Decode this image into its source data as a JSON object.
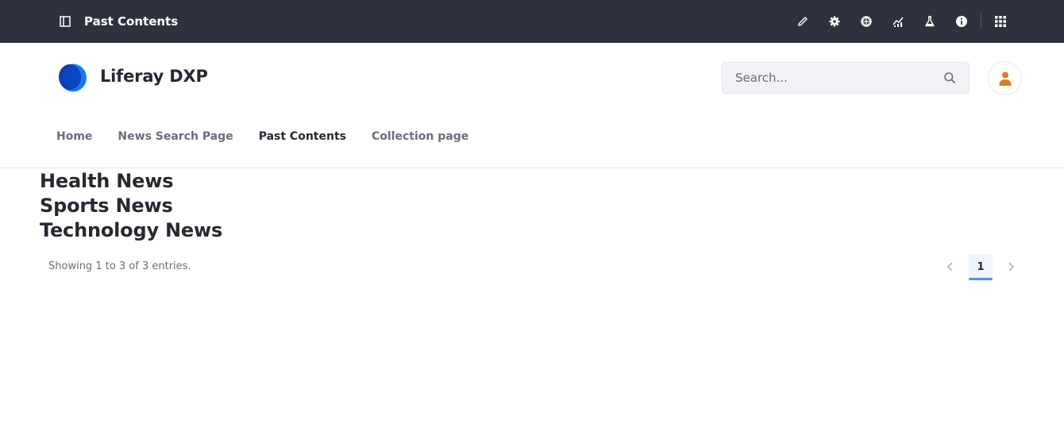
{
  "control_menu": {
    "title": "Past Contents",
    "icons": [
      "pencil-icon",
      "gear-icon",
      "simulation-icon",
      "analytics-icon",
      "flask-icon",
      "info-icon",
      "apps-grid-icon"
    ]
  },
  "header": {
    "site_name": "Liferay DXP",
    "search": {
      "placeholder": "Search...",
      "value": ""
    }
  },
  "nav": {
    "items": [
      {
        "label": "Home"
      },
      {
        "label": "News Search Page"
      },
      {
        "label": "Past Contents"
      },
      {
        "label": "Collection page"
      }
    ],
    "active": "Past Contents"
  },
  "content": {
    "titles": [
      "Health News",
      "Sports News",
      "Technology News"
    ]
  },
  "pagination": {
    "results_text": "Showing 1 to 3 of 3 entries.",
    "current_page": "1"
  },
  "colors": {
    "control_menu_bg": "#30313f",
    "accent": "#528eff",
    "avatar_orange": "#e07b1f",
    "logo_blue": "#0b5fff"
  }
}
